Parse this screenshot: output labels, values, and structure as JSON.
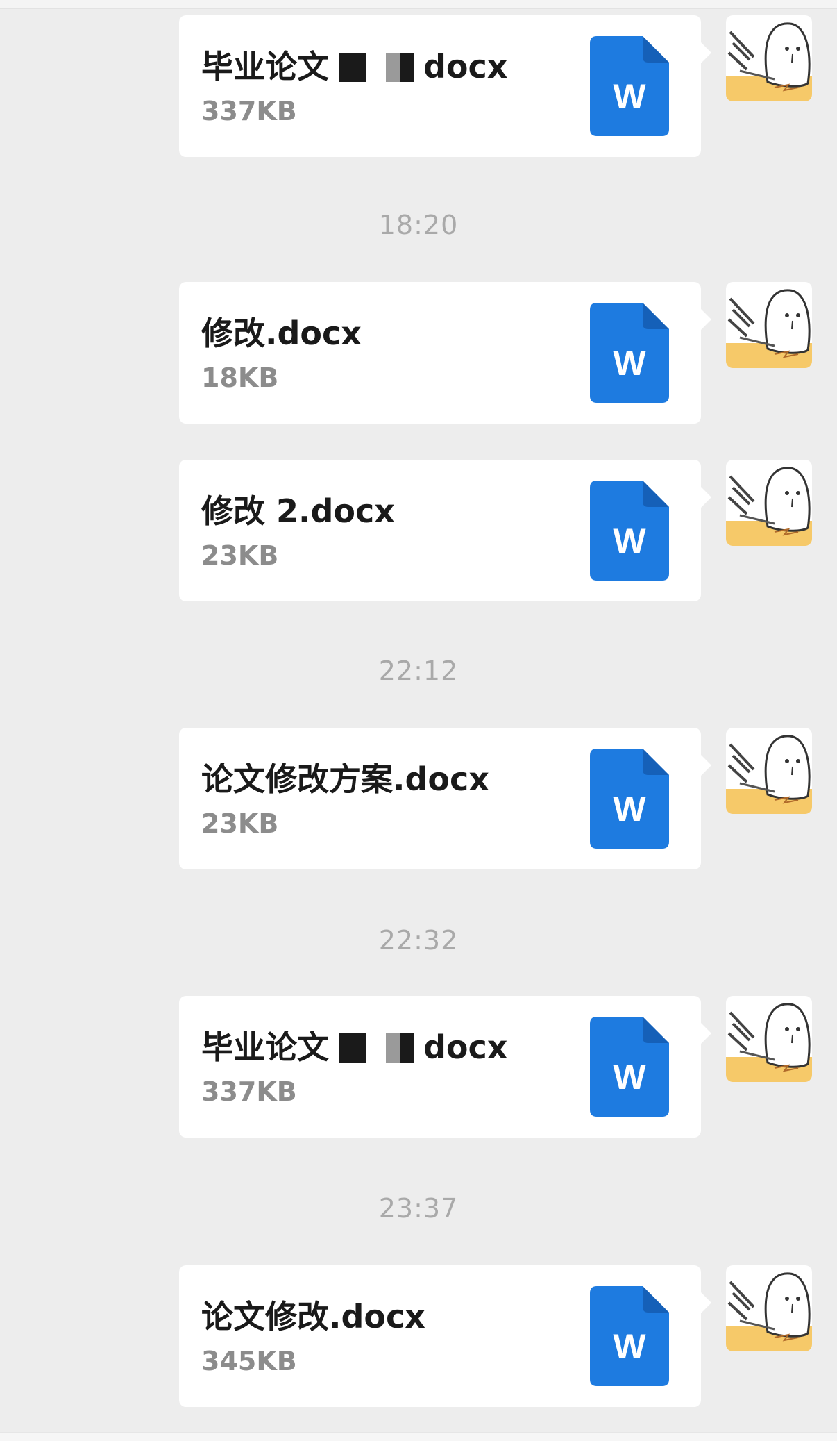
{
  "timestamps": [
    "18:20",
    "22:12",
    "22:32",
    "23:37"
  ],
  "messages": [
    {
      "name_prefix": "毕业论文",
      "name_suffix": "docx",
      "name_redacted": true,
      "size": "337KB",
      "icon": "word-doc-icon",
      "icon_letter": "W"
    },
    {
      "name": "修改.docx",
      "size": "18KB",
      "icon": "word-doc-icon",
      "icon_letter": "W"
    },
    {
      "name": "修改 2.docx",
      "size": "23KB",
      "icon": "word-doc-icon",
      "icon_letter": "W"
    },
    {
      "name": "论文修改方案.docx",
      "size": "23KB",
      "icon": "word-doc-icon",
      "icon_letter": "W"
    },
    {
      "name_prefix": "毕业论文",
      "name_suffix": "docx",
      "name_redacted": true,
      "size": "337KB",
      "icon": "word-doc-icon",
      "icon_letter": "W"
    },
    {
      "name": "论文修改.docx",
      "size": "345KB",
      "icon": "word-doc-icon",
      "icon_letter": "W"
    }
  ],
  "colors": {
    "background": "#ededed",
    "bubble": "#ffffff",
    "word_blue": "#1e7be0",
    "timestamp": "#a9a9a9"
  }
}
